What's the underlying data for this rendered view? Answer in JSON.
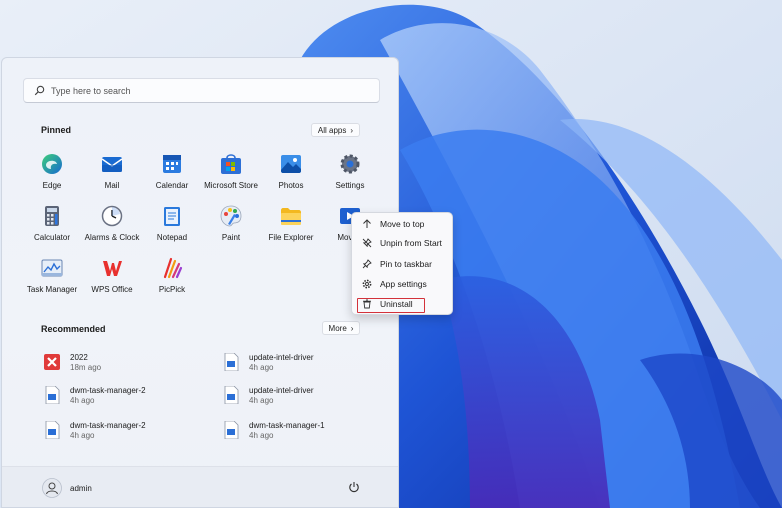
{
  "search": {
    "placeholder": "Type here to search"
  },
  "pinned": {
    "heading": "Pinned",
    "all_apps": "All apps",
    "apps": [
      {
        "label": "Edge",
        "icon": "edge-icon"
      },
      {
        "label": "Mail",
        "icon": "mail-icon"
      },
      {
        "label": "Calendar",
        "icon": "calendar-icon"
      },
      {
        "label": "Microsoft Store",
        "icon": "store-icon"
      },
      {
        "label": "Photos",
        "icon": "photos-icon"
      },
      {
        "label": "Settings",
        "icon": "gear-icon"
      },
      {
        "label": "Calculator",
        "icon": "calculator-icon"
      },
      {
        "label": "Alarms & Clock",
        "icon": "clock-icon"
      },
      {
        "label": "Notepad",
        "icon": "notepad-icon"
      },
      {
        "label": "Paint",
        "icon": "paint-icon"
      },
      {
        "label": "File Explorer",
        "icon": "folder-icon"
      },
      {
        "label": "Movies",
        "icon": "movies-icon"
      },
      {
        "label": "Task Manager",
        "icon": "task-manager-icon"
      },
      {
        "label": "WPS Office",
        "icon": "wps-icon"
      },
      {
        "label": "PicPick",
        "icon": "picpick-icon"
      }
    ]
  },
  "recommended": {
    "heading": "Recommended",
    "more": "More",
    "items": [
      {
        "name": "2022",
        "time": "18m ago"
      },
      {
        "name": "update-intel-driver",
        "time": "4h ago"
      },
      {
        "name": "dwm-task-manager-2",
        "time": "4h ago"
      },
      {
        "name": "update-intel-driver",
        "time": "4h ago"
      },
      {
        "name": "dwm-task-manager-2",
        "time": "4h ago"
      },
      {
        "name": "dwm-task-manager-1",
        "time": "4h ago"
      }
    ]
  },
  "user": {
    "name": "admin"
  },
  "context_menu": {
    "items": [
      {
        "label": "Move to top",
        "icon": "arrow-up-icon"
      },
      {
        "label": "Unpin from Start",
        "icon": "unpin-icon"
      },
      {
        "label": "Pin to taskbar",
        "icon": "pin-icon"
      },
      {
        "label": "App settings",
        "icon": "gear-icon"
      },
      {
        "label": "Uninstall",
        "icon": "trash-icon"
      }
    ]
  },
  "colors": {
    "highlight": "#d3323a",
    "accent": "#1f6fd6"
  }
}
